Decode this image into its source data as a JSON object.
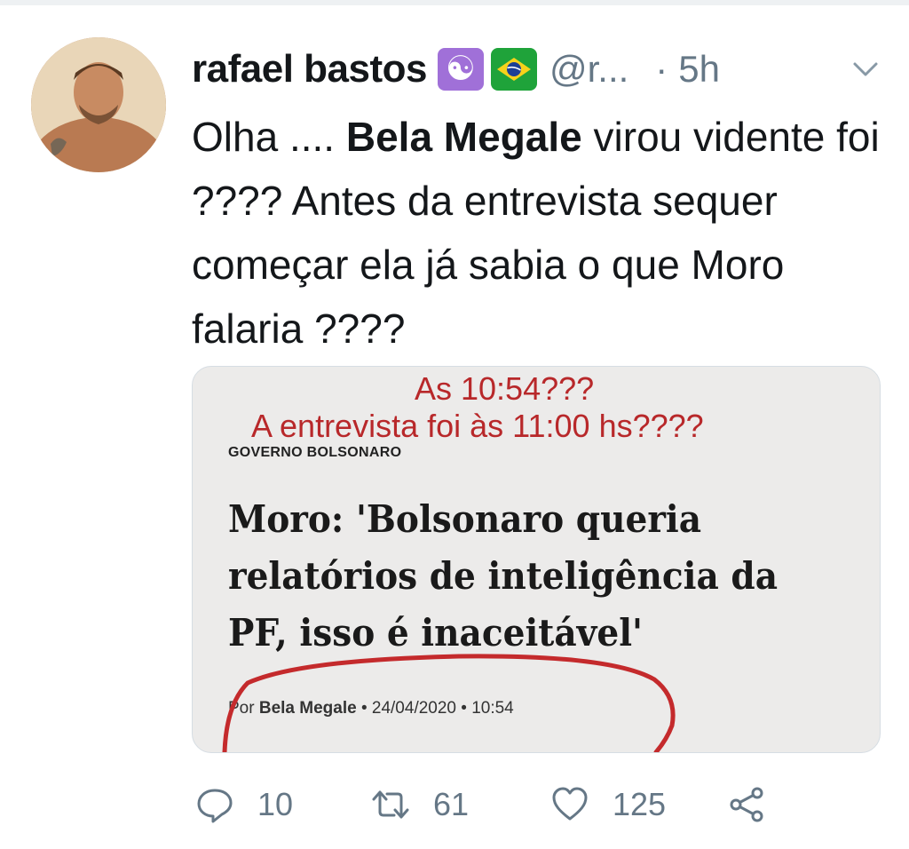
{
  "tweet": {
    "author": {
      "display_name": "rafael bastos",
      "handle": "@r...",
      "badges": [
        "yin-yang-emoji",
        "brazil-flag-emoji"
      ],
      "badge_glyph": "☯"
    },
    "separator": "·",
    "time": "5h",
    "text": {
      "part1": "Olha .... ",
      "bold": "Bela Megale",
      "part2": " virou vidente foi ???? Antes da entrevista sequer começar ela já sabia o que Moro falaria ????"
    },
    "media": {
      "annotation_line1": "As 10:54???",
      "annotation_line2": "A entrevista foi às 11:00 hs????",
      "section": "GOVERNO BOLSONARO",
      "headline": "Moro: 'Bolsonaro queria relatórios de inteligência da PF, isso é inaceitável'",
      "byline_prefix": "Por ",
      "byline_author": "Bela Megale",
      "byline_rest": " • 24/04/2020 • 10:54",
      "annotation_color": "#b8282a"
    },
    "actions": {
      "replies": "10",
      "retweets": "61",
      "likes": "125",
      "icons": [
        "reply-icon",
        "retweet-icon",
        "like-icon",
        "share-icon"
      ]
    },
    "colors": {
      "text": "#14171a",
      "secondary": "#657786",
      "background": "#ffffff"
    }
  }
}
